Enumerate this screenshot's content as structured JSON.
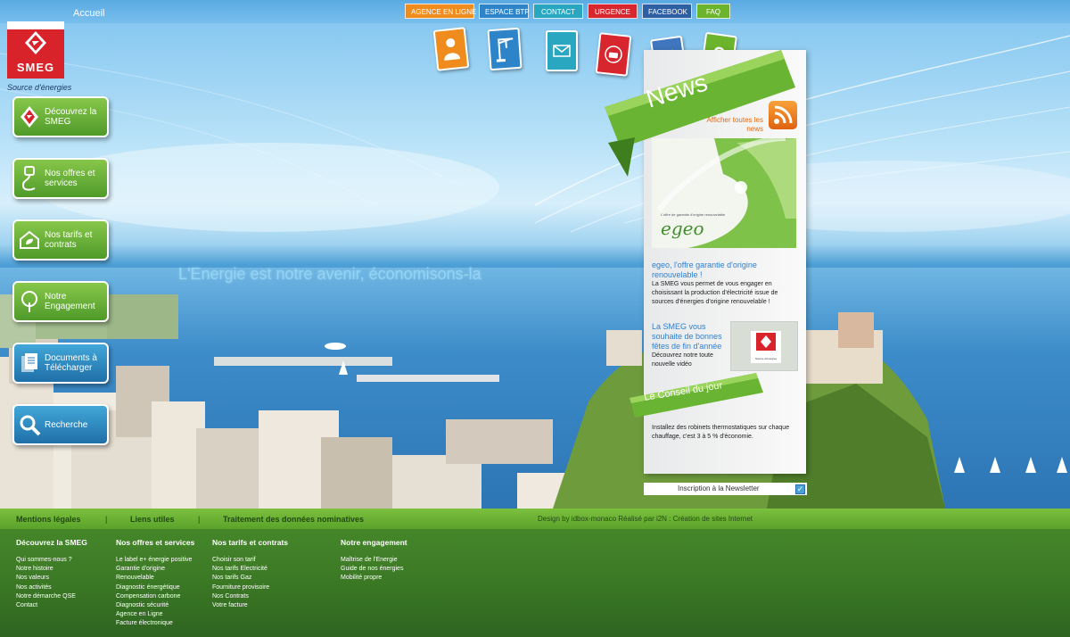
{
  "topnav": {
    "home": "Accueil",
    "items": [
      "AGENCE EN LIGNE",
      "ESPACE BTP",
      "CONTACT",
      "URGENCE",
      "FACEBOOK",
      "FAQ"
    ]
  },
  "logo": {
    "brand": "SMEG",
    "tagline": "Source d'énergies"
  },
  "leftmenu": [
    {
      "label": "Découvrez la SMEG",
      "icon": "smeg-diamond-icon"
    },
    {
      "label": "Nos offres et services",
      "icon": "plug-icon"
    },
    {
      "label": "Nos tarifs et contrats",
      "icon": "eco-house-icon"
    },
    {
      "label": "Notre Engagement",
      "icon": "tree-icon"
    },
    {
      "label": "Documents à Télécharger",
      "icon": "documents-icon"
    },
    {
      "label": "Recherche",
      "icon": "magnifier-icon"
    }
  ],
  "slogan": "L'Energie est notre avenir, économisons-la",
  "news": {
    "title": "News",
    "all_link": "Afficher toutes les news",
    "egeo_caption": "L'offre de garantie d'origine renouvelable",
    "egeo_word": "egeo",
    "item1_title": "egeo, l'offre garantie d'origine renouvelable !",
    "item1_body": "La SMEG vous permet de vous engager en choisissant la production d'électricité issue de sources d'énergies d'origine renouvelable !",
    "item2_title": "La SMEG vous souhaite de bonnes fêtes de fin d'année",
    "item2_body": "Découvrez notre toute nouvelle vidéo",
    "thumb_brand": "SMEG",
    "thumb_tagline": "Source d'énergies"
  },
  "conseil": {
    "title": "Le Conseil du jour",
    "text": "Installez des robinets thermostatiques sur chaque chauffage, c'est 3 à 5 % d'économie."
  },
  "newsletter": {
    "label": "Inscription à la Newsletter"
  },
  "footer_bar": {
    "links": [
      "Mentions légales",
      "Liens utiles",
      "Traitement des données nominatives"
    ],
    "separator": "|",
    "credit": "Design by idbox-monaco Réalisé par i2N : Création de sites Internet"
  },
  "footer": [
    {
      "title": "Découvrez la SMEG",
      "items": [
        "Qui sommes-nous ?",
        "Notre histoire",
        "Nos valeurs",
        "Nos activités",
        "Notre démarche QSE",
        "Contact"
      ]
    },
    {
      "title": "Nos offres et services",
      "items": [
        "Le label e+ énergie positive",
        "Garantie d'origine",
        "Renouvelable",
        "Diagnostic énergétique",
        "Compensation carbone",
        "Diagnostic sécurité",
        "Agence en Ligne",
        "Facture électronique"
      ]
    },
    {
      "title": "Nos tarifs et contrats",
      "items": [
        "Choisir son tarif",
        "Nos tarifs Electricité",
        "Nos tarifs Gaz",
        "Fourniture provisoire",
        "Nos Contrats",
        "Votre facture"
      ]
    },
    {
      "title": "Notre engagement",
      "items": [
        "Maîtrise de l'Energie",
        "Guide de nos énergies",
        "Mobilité propre"
      ]
    }
  ]
}
